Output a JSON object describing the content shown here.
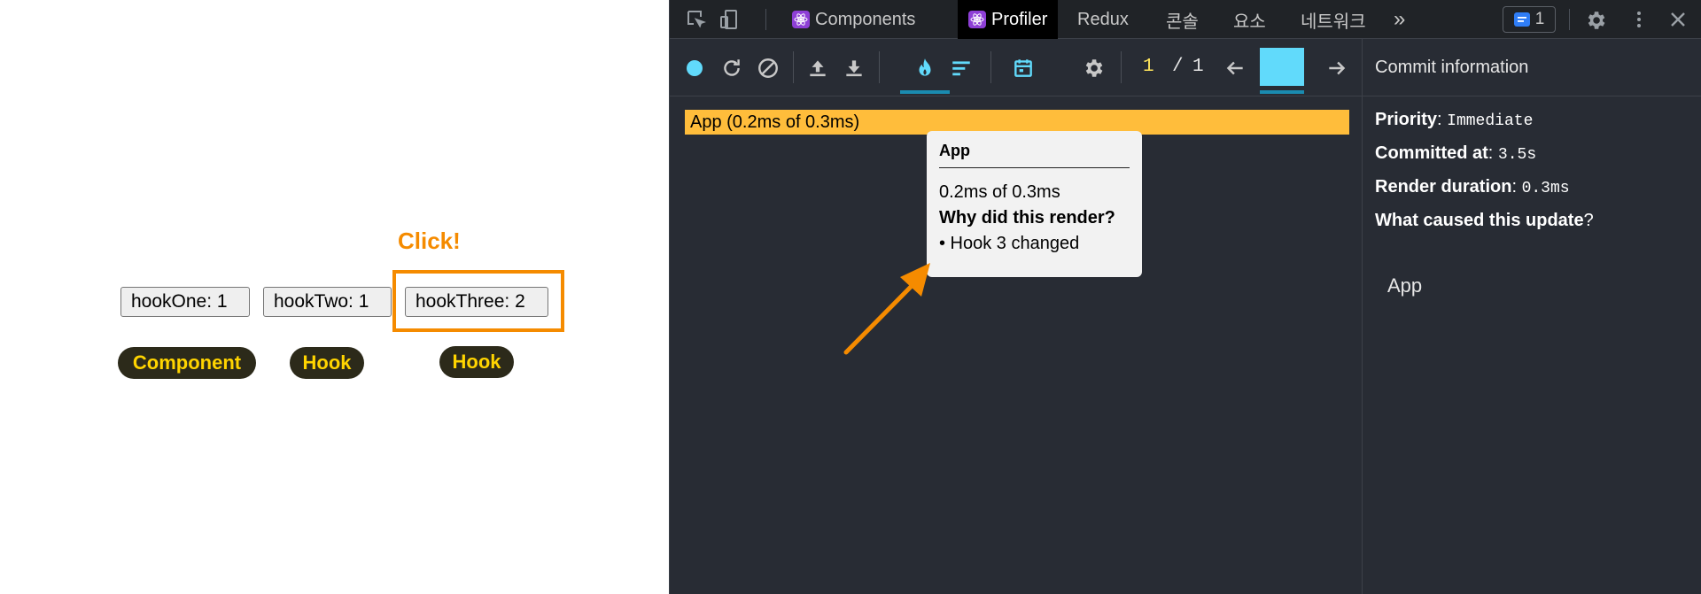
{
  "page": {
    "click_label": "Click!",
    "buttons": [
      "hookOne: 1",
      "hookTwo: 1",
      "hookThree: 2"
    ],
    "pills": [
      "Component",
      "Hook",
      "Hook"
    ]
  },
  "devtools": {
    "tabs": {
      "components": "Components",
      "profiler": "Profiler",
      "redux": "Redux",
      "console": "콘솔",
      "elements": "요소",
      "network": "네트워크",
      "more": "»"
    },
    "issues_count": "1",
    "commit": {
      "current": "1",
      "separator": "/",
      "total": "1"
    },
    "flame_row_label": "App (0.2ms of 0.3ms)",
    "tooltip": {
      "title": "App",
      "duration": "0.2ms of 0.3ms",
      "why_label": "Why did this render?",
      "reason": "• Hook 3 changed"
    },
    "commit_info": {
      "header": "Commit information",
      "priority_label": "Priority",
      "priority_value": "Immediate",
      "committed_label": "Committed at",
      "committed_value": "3.5s",
      "render_label": "Render duration",
      "render_value": "0.3ms",
      "caused_label": "What caused this update",
      "caused_value": "App"
    }
  },
  "colors": {
    "accent_orange": "#f58b00",
    "flame_yellow": "#ffbd3b",
    "react_blue": "#61dafb",
    "pill_text": "#ffd400",
    "devtools_bg": "#282c34"
  },
  "icons": [
    "inspect-icon",
    "device-icon",
    "record-icon",
    "reload-icon",
    "clear-icon",
    "upload-icon",
    "download-icon",
    "flame-icon",
    "ranked-icon",
    "timeline-icon",
    "gear-icon",
    "arrow-left-icon",
    "arrow-right-icon",
    "settings-icon",
    "more-vert-icon",
    "close-icon"
  ]
}
